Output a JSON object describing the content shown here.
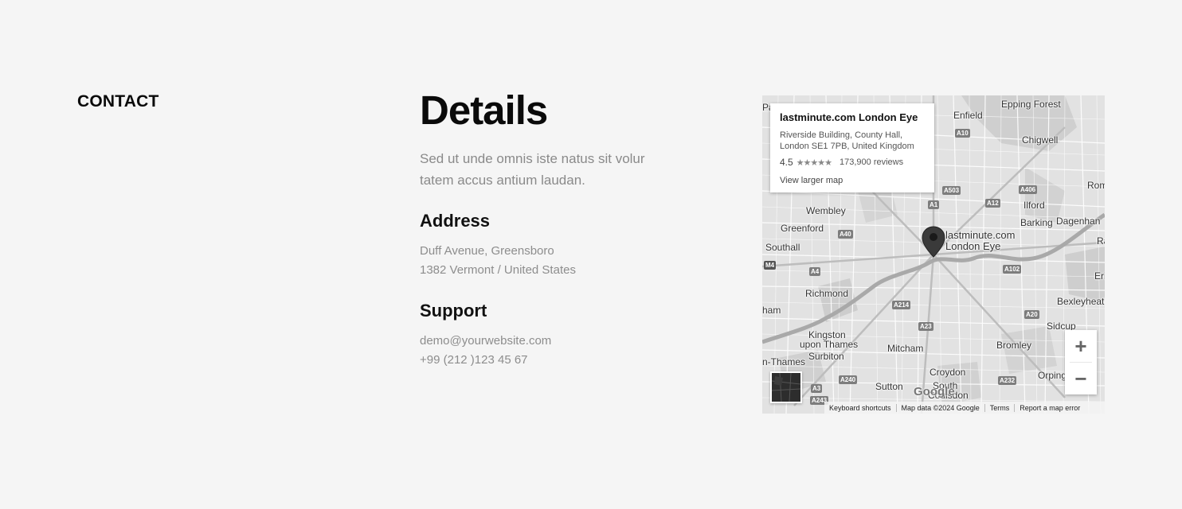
{
  "section": {
    "label": "CONTACT"
  },
  "details": {
    "title": "Details",
    "intro": "Sed ut unde omnis iste natus sit volur tatem accus antium laudan.",
    "address": {
      "heading": "Address",
      "line1": "Duff Avenue, Greensboro",
      "line2": "1382 Vermont / United States"
    },
    "support": {
      "heading": "Support",
      "email": "demo@yourwebsite.com",
      "phone": "+99 (212 )123 45 67"
    }
  },
  "map": {
    "infocard": {
      "name": "lastminute.com London Eye",
      "address_line1": "Riverside Building, County Hall,",
      "address_line2": "London SE1 7PB, United Kingdom",
      "rating": "4.5",
      "stars": "★★★★★",
      "reviews": "173,900 reviews",
      "link": "View larger map"
    },
    "pin_label_line1": "lastminute.com",
    "pin_label_line2": "London Eye",
    "places": {
      "epping": "Epping Forest",
      "enfield": "Enfield",
      "chigwell": "Chigwell",
      "rom": "Rom",
      "wembley": "Wembley",
      "ilford": "Ilford",
      "greenford": "Greenford",
      "barking": "Barking",
      "dagenham": "Dagenhan",
      "southall": "Southall",
      "ra": "Ra",
      "eri": "Eri",
      "richmond": "Richmond",
      "bexleyheath": "Bexleyheatl",
      "ham": "ham",
      "sidcup": "Sidcup",
      "kingston": "Kingston",
      "upon_thames": "upon Thames",
      "mitcham": "Mitcham",
      "bromley": "Bromley",
      "thames": "n-Thames",
      "surbiton": "Surbiton",
      "croydon": "Croydon",
      "orping": "Orping",
      "sutton": "Sutton",
      "south": "South",
      "coulsdon": "Coulsdon",
      "pa": "Pa"
    },
    "roads": {
      "a10": "A10",
      "a503": "A503",
      "a406": "A406",
      "a1": "A1",
      "a12": "A12",
      "a40": "A40",
      "m4": "M4",
      "a4": "A4",
      "a102": "A102",
      "a214": "A214",
      "a20": "A20",
      "a23": "A23",
      "a240": "A240",
      "a232": "A232",
      "a3": "A3",
      "a243": "A243"
    },
    "logo": "Google",
    "zoom_in": "+",
    "zoom_out": "−",
    "footer": {
      "shortcuts": "Keyboard shortcuts",
      "data": "Map data ©2024 Google",
      "terms": "Terms",
      "report": "Report a map error"
    }
  }
}
